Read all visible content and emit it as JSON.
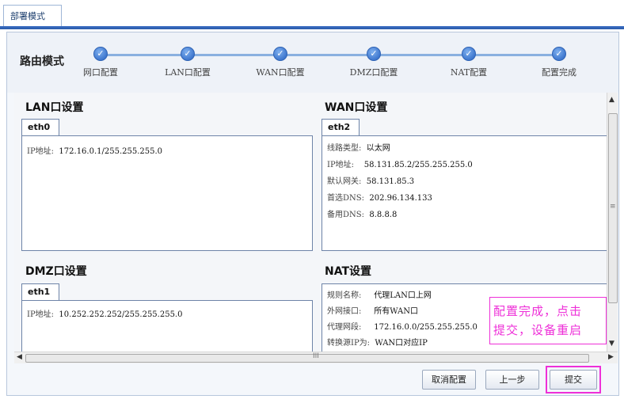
{
  "tab": {
    "label": "部署模式"
  },
  "steps": {
    "mode_label": "路由模式",
    "items": [
      {
        "label": "网口配置",
        "status": "done"
      },
      {
        "label": "LAN口配置",
        "status": "done"
      },
      {
        "label": "WAN口配置",
        "status": "done"
      },
      {
        "label": "DMZ口配置",
        "status": "done"
      },
      {
        "label": "NAT配置",
        "status": "done"
      },
      {
        "label": "配置完成",
        "status": "done"
      }
    ],
    "check_glyph": "✓"
  },
  "lan": {
    "title": "LAN口设置",
    "tab": "eth0",
    "ip_label": "IP地址:",
    "ip_value": "172.16.0.1/255.255.255.0"
  },
  "wan": {
    "title": "WAN口设置",
    "tab": "eth2",
    "rows": [
      {
        "label": "线路类型:",
        "value": "以太网"
      },
      {
        "label": "IP地址:",
        "value": "58.131.85.2/255.255.255.0"
      },
      {
        "label": "默认网关:",
        "value": "58.131.85.3"
      },
      {
        "label": "首选DNS:",
        "value": "202.96.134.133"
      },
      {
        "label": "备用DNS:",
        "value": "8.8.8.8"
      }
    ]
  },
  "dmz": {
    "title": "DMZ口设置",
    "tab": "eth1",
    "ip_label": "IP地址:",
    "ip_value": "10.252.252.252/255.255.255.0"
  },
  "nat": {
    "title": "NAT设置",
    "rows": [
      {
        "label": "规则名称:",
        "value": "代理LAN口上网"
      },
      {
        "label": "外网接口:",
        "value": "所有WAN口"
      },
      {
        "label": "代理网段:",
        "value": "172.16.0.0/255.255.255.0"
      },
      {
        "label": "转换源IP为:",
        "value": "WAN口对应IP"
      }
    ]
  },
  "scroll": {
    "up": "▲",
    "down": "▼",
    "left": "◀",
    "right": "▶",
    "v_grip": "≡",
    "h_grip": "III"
  },
  "buttons": {
    "cancel": "取消配置",
    "prev": "上一步",
    "submit": "提交"
  },
  "annotation": {
    "line1": "配置完成，点击",
    "line2": "提交，设备重启",
    "color": "#ee30d8"
  },
  "colors": {
    "accent": "#3b6fc4",
    "step_dot": "#3f78cf"
  }
}
